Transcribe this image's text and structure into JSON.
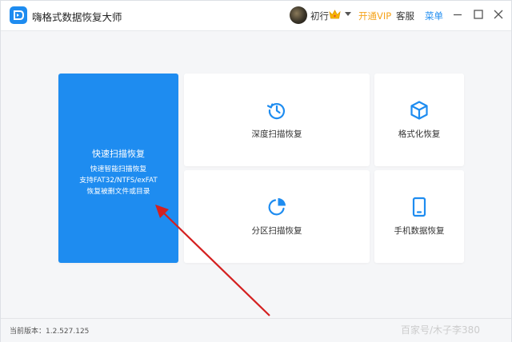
{
  "titlebar": {
    "app_title": "嗨格式数据恢复大师",
    "username": "初行",
    "vip_label": "开通VIP",
    "service_label": "客服",
    "menu_label": "菜单"
  },
  "cards": {
    "quick": {
      "title": "快速扫描恢复",
      "desc_line1": "快速智能扫描恢复",
      "desc_line2": "支持FAT32/NTFS/exFAT",
      "desc_line3": "恢复被删文件或目录"
    },
    "deep": {
      "label": "深度扫描恢复",
      "icon": "history-icon"
    },
    "format": {
      "label": "格式化恢复",
      "icon": "cube-icon"
    },
    "partition": {
      "label": "分区扫描恢复",
      "icon": "pie-chart-icon"
    },
    "phone": {
      "label": "手机数据恢复",
      "icon": "phone-icon"
    }
  },
  "statusbar": {
    "version_text": "当前版本：1.2.527.125",
    "watermark": "百家号/木子李380"
  },
  "colors": {
    "accent": "#1e8cf0",
    "vip": "#f5a31a",
    "arrow": "#d42020"
  }
}
